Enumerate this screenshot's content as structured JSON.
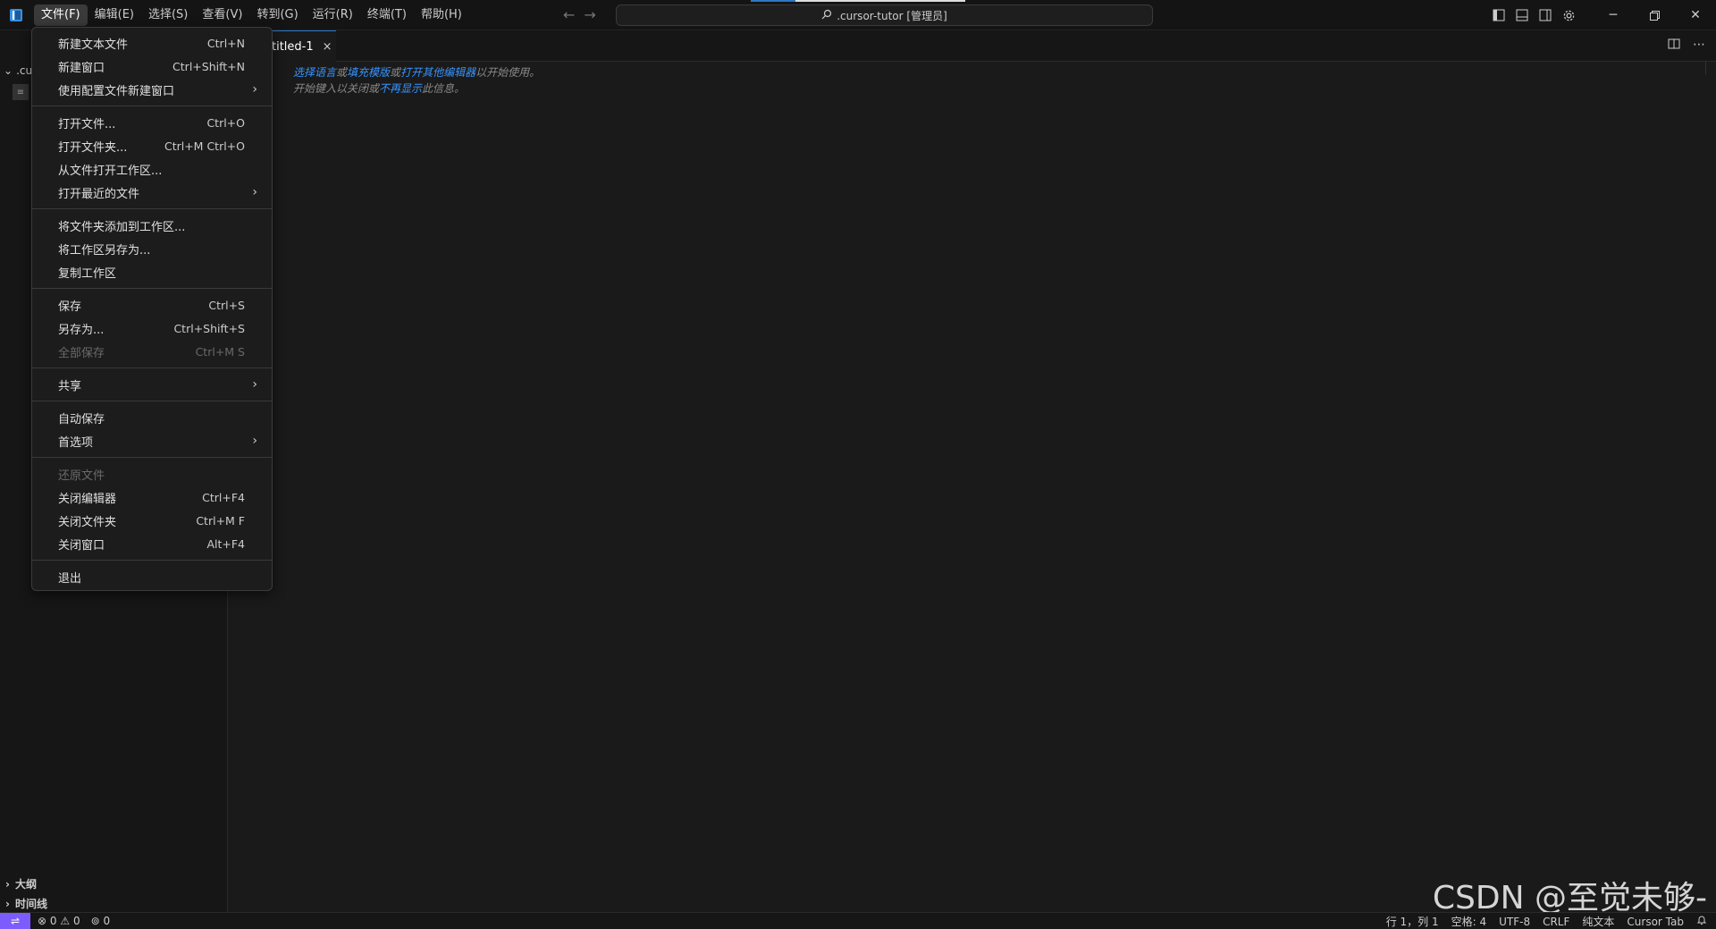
{
  "menubar": [
    "文件(F)",
    "编辑(E)",
    "选择(S)",
    "查看(V)",
    "转到(G)",
    "运行(R)",
    "终端(T)",
    "帮助(H)"
  ],
  "command_center": ".cursor-tutor [管理员]",
  "sidebar": {
    "folder": ".cu",
    "panels": [
      "大纲",
      "时间线"
    ]
  },
  "tab": {
    "label": "titled-1",
    "close": "×"
  },
  "editor_hint": {
    "line1": {
      "select_language": "选择语言",
      "or1": "或",
      "fill_template": "填充模版",
      "or2": "或",
      "open_other_editor": "打开其他编辑器",
      "suffix": "以开始使用。"
    },
    "line2": {
      "prefix": "开始键入以关闭或",
      "dont_show": "不再显示",
      "suffix": "此信息。"
    }
  },
  "file_menu": [
    [
      {
        "label": "新建文本文件",
        "shortcut": "Ctrl+N"
      },
      {
        "label": "新建窗口",
        "shortcut": "Ctrl+Shift+N"
      },
      {
        "label": "使用配置文件新建窗口",
        "shortcut": "",
        "submenu": true
      }
    ],
    [
      {
        "label": "打开文件...",
        "shortcut": "Ctrl+O"
      },
      {
        "label": "打开文件夹...",
        "shortcut": "Ctrl+M Ctrl+O"
      },
      {
        "label": "从文件打开工作区...",
        "shortcut": ""
      },
      {
        "label": "打开最近的文件",
        "shortcut": "",
        "submenu": true
      }
    ],
    [
      {
        "label": "将文件夹添加到工作区...",
        "shortcut": ""
      },
      {
        "label": "将工作区另存为...",
        "shortcut": ""
      },
      {
        "label": "复制工作区",
        "shortcut": ""
      }
    ],
    [
      {
        "label": "保存",
        "shortcut": "Ctrl+S"
      },
      {
        "label": "另存为...",
        "shortcut": "Ctrl+Shift+S"
      },
      {
        "label": "全部保存",
        "shortcut": "Ctrl+M S",
        "disabled": true
      }
    ],
    [
      {
        "label": "共享",
        "shortcut": "",
        "submenu": true
      }
    ],
    [
      {
        "label": "自动保存",
        "shortcut": ""
      },
      {
        "label": "首选项",
        "shortcut": "",
        "submenu": true
      }
    ],
    [
      {
        "label": "还原文件",
        "shortcut": "",
        "disabled": true
      },
      {
        "label": "关闭编辑器",
        "shortcut": "Ctrl+F4"
      },
      {
        "label": "关闭文件夹",
        "shortcut": "Ctrl+M F"
      },
      {
        "label": "关闭窗口",
        "shortcut": "Alt+F4"
      }
    ],
    [
      {
        "label": "退出",
        "shortcut": ""
      }
    ]
  ],
  "statusbar": {
    "errors": "0",
    "warnings": "0",
    "ports": "0",
    "position": "行 1，列 1",
    "spaces": "空格: 4",
    "encoding": "UTF-8",
    "eol": "CRLF",
    "language": "纯文本",
    "cursor_tab": "Cursor Tab"
  },
  "watermark": "CSDN @至觉未够-",
  "colors": {
    "accent": "#2b78c5",
    "link": "#3794ff",
    "remote": "#7c5cff",
    "background": "#1a1a1a"
  }
}
